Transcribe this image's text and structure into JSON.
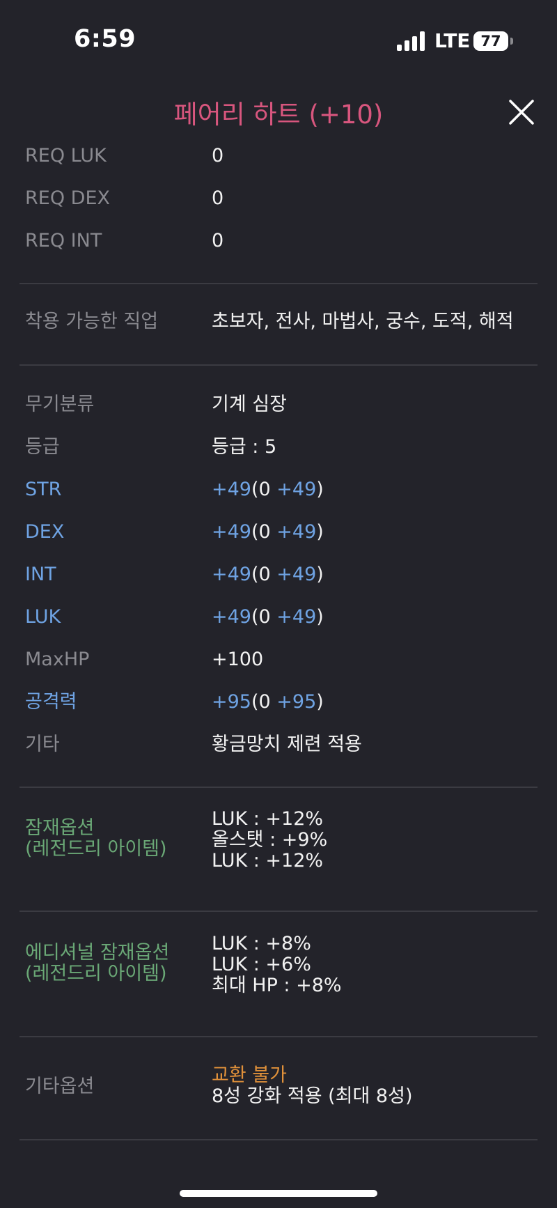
{
  "status_bar": {
    "time": "6:59",
    "network": "LTE",
    "battery": "77"
  },
  "header": {
    "title": "페어리 하트 (+10)",
    "close_icon": "close-icon"
  },
  "requirements": [
    {
      "label": "REQ LUK",
      "value": "0"
    },
    {
      "label": "REQ DEX",
      "value": "0"
    },
    {
      "label": "REQ INT",
      "value": "0"
    }
  ],
  "jobs": {
    "label": "착용 가능한 직업",
    "value": "초보자, 전사, 마법사, 궁수, 도적, 해적"
  },
  "stats": {
    "weapon_type": {
      "label": "무기분류",
      "value": "기계 심장"
    },
    "grade": {
      "label": "등급",
      "value": "등급 : 5"
    },
    "str": {
      "label": "STR",
      "total": "+49",
      "base": "(0 ",
      "bonus": "+49",
      "close": ")"
    },
    "dex": {
      "label": "DEX",
      "total": "+49",
      "base": "(0 ",
      "bonus": "+49",
      "close": ")"
    },
    "int": {
      "label": "INT",
      "total": "+49",
      "base": "(0 ",
      "bonus": "+49",
      "close": ")"
    },
    "luk": {
      "label": "LUK",
      "total": "+49",
      "base": "(0 ",
      "bonus": "+49",
      "close": ")"
    },
    "maxhp": {
      "label": "MaxHP",
      "value": "+100"
    },
    "attack": {
      "label": "공격력",
      "total": "+95",
      "base": "(0 ",
      "bonus": "+95",
      "close": ")"
    },
    "etc": {
      "label": "기타",
      "value": "황금망치 제련 적용"
    }
  },
  "potential": {
    "label_line1": "잠재옵션",
    "label_line2": "(레전드리 아이템)",
    "lines": [
      "LUK : +12%",
      "올스탯 : +9%",
      "LUK : +12%"
    ]
  },
  "additional_potential": {
    "label_line1": "에디셔널 잠재옵션",
    "label_line2": "(레전드리 아이템)",
    "lines": [
      "LUK : +8%",
      "LUK : +6%",
      "최대 HP : +8%"
    ]
  },
  "other_options": {
    "label": "기타옵션",
    "trade": "교환 불가",
    "star_force": "8성 강화 적용 (최대 8성)"
  },
  "colors": {
    "background": "#23232a",
    "title": "#d8567e",
    "stat_blue": "#6fa3e3",
    "potential_green": "#6aa876",
    "trade_orange": "#e0913a",
    "label_gray": "#8a8a90"
  }
}
